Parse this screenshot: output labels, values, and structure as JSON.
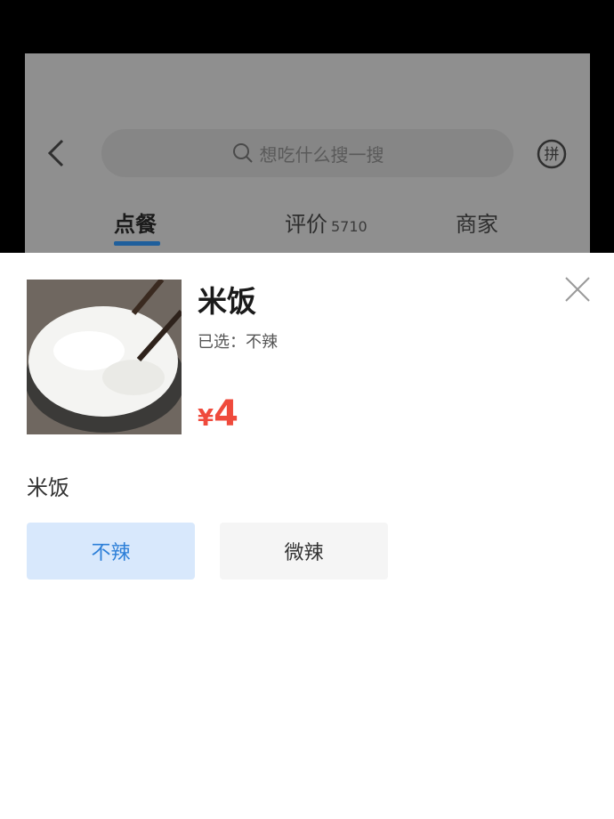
{
  "header": {
    "search_placeholder": "想吃什么搜一搜",
    "icons": {
      "back": "back-chevron-icon",
      "search": "search-icon",
      "group": "pin-icon"
    }
  },
  "tabs": [
    {
      "label": "点餐",
      "active": true
    },
    {
      "label": "评价",
      "count": "5710"
    },
    {
      "label": "商家"
    }
  ],
  "sheet": {
    "item_name": "米饭",
    "selected_label": "已选：",
    "selected_value": "不辣",
    "price_symbol": "¥",
    "price": "4",
    "section_title": "米饭",
    "options": [
      {
        "label": "不辣",
        "selected": true
      },
      {
        "label": "微辣",
        "selected": false
      }
    ],
    "colors": {
      "price": "#ef4a3c",
      "selected_bg": "#d8e8fc",
      "selected_text": "#2d7fd8",
      "tab_underline": "#1f5f9c"
    }
  }
}
